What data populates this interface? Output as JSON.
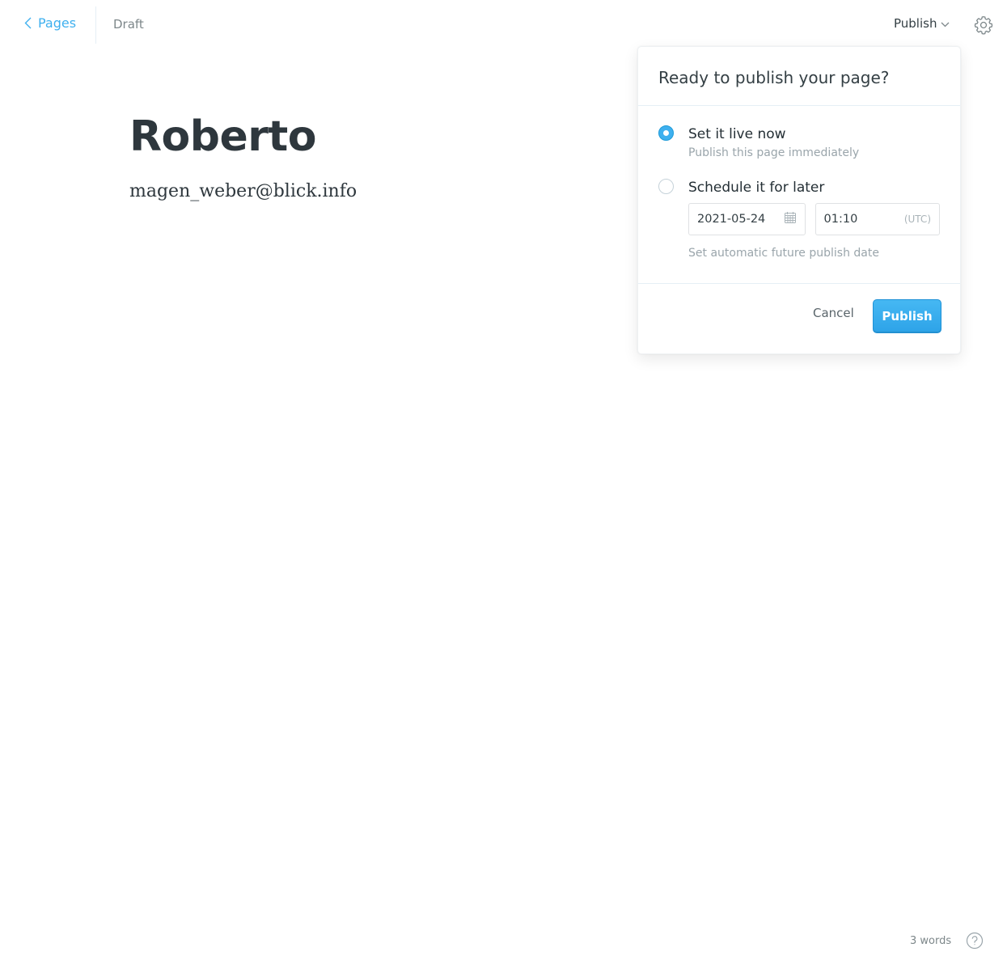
{
  "topbar": {
    "back_label": "Pages",
    "status": "Draft",
    "publish_label": "Publish"
  },
  "editor": {
    "title": "Roberto",
    "body": "magen_weber@blick.info"
  },
  "publish_panel": {
    "heading": "Ready to publish your page?",
    "options": [
      {
        "title": "Set it live now",
        "description": "Publish this page immediately",
        "selected": true
      },
      {
        "title": "Schedule it for later",
        "selected": false
      }
    ],
    "schedule": {
      "date": "2021-05-24",
      "time": "01:10",
      "timezone": "(UTC)",
      "hint": "Set automatic future publish date"
    },
    "cancel_label": "Cancel",
    "publish_label": "Publish"
  },
  "footer": {
    "word_count": "3 words"
  },
  "colors": {
    "accent": "#3eb0ef",
    "text": "#15212a",
    "muted": "#9aa5ab"
  },
  "icons": {
    "back": "chevron-left-icon",
    "dropdown": "chevron-down-icon",
    "settings": "gear-icon",
    "calendar": "calendar-icon",
    "help": "question-circle-icon"
  }
}
